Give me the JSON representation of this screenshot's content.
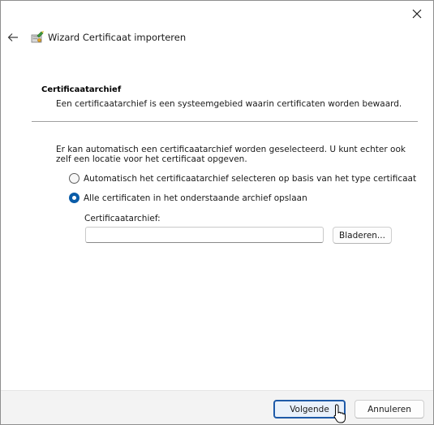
{
  "window": {
    "title": "Wizard Certificaat importeren",
    "close_icon": "close-icon",
    "back_icon": "arrow-left-icon"
  },
  "section": {
    "heading": "Certificaatarchief",
    "description": "Een certificaatarchief is een systeemgebied waarin certificaten worden bewaard."
  },
  "body": {
    "intro": "Er kan automatisch een certificaatarchief worden geselecteerd. U kunt echter ook zelf een locatie voor het certificaat opgeven.",
    "options": [
      {
        "label": "Automatisch het certificaatarchief selecteren op basis van het type certificaat",
        "selected": false
      },
      {
        "label": "Alle certificaten in het onderstaande archief opslaan",
        "selected": true
      }
    ],
    "store_label": "Certificaatarchief:",
    "store_value": "",
    "browse_label": "Bladeren..."
  },
  "footer": {
    "next_label": "Volgende",
    "cancel_label": "Annuleren"
  },
  "colors": {
    "accent": "#0a5ca8",
    "footer_bg": "#f3f3f3"
  }
}
